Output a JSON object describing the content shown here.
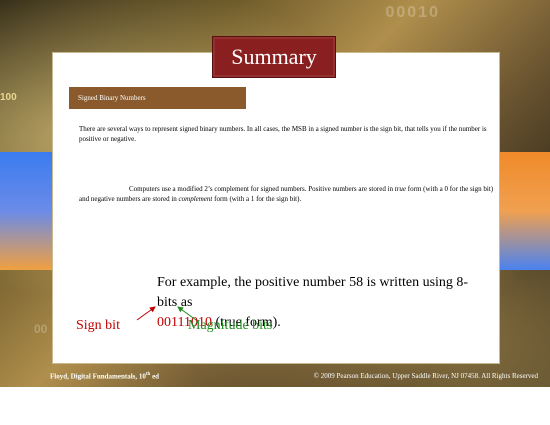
{
  "title": "Summary",
  "section_header": "Signed Binary Numbers",
  "para1": "There are several ways to represent signed binary numbers. In all cases, the MSB in a signed number is the sign bit, that tells you if the number is positive or negative.",
  "para2": {
    "part1": "Computers use a modified 2’s complement for signed numbers. Positive numbers are stored in ",
    "em1": "true",
    "part2": " form (with a 0 for the sign bit) and negative numbers are stored in ",
    "em2": "complement",
    "part3": " form (with a 1 for the sign bit)."
  },
  "example": {
    "line1": "For example, the positive number 58 is written using 8-bits as",
    "binary": "00111010",
    "suffix": " (true form)."
  },
  "labels": {
    "sign_bit": "Sign bit",
    "magnitude_bits": "Magnitude bits"
  },
  "footer": {
    "left_main": "Floyd, Digital Fundamentals, 10",
    "left_sup": "th",
    "left_suffix": " ed",
    "right": "© 2009 Pearson Education, Upper Saddle River, NJ 07458. All Rights Reserved"
  },
  "background_digits": {
    "left": "100",
    "top": "00010",
    "low": "00"
  },
  "colors": {
    "title_bg": "#8a1f1f",
    "header_bg": "#8a5a2c",
    "sign": "#c00000",
    "magnitude": "#228b22"
  }
}
